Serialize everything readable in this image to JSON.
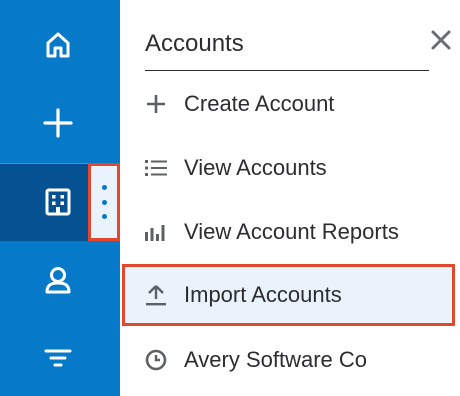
{
  "sidebar": {
    "items": [
      {
        "name": "home",
        "icon": "home-icon"
      },
      {
        "name": "create",
        "icon": "plus-icon"
      },
      {
        "name": "accounts",
        "icon": "building-icon",
        "active": true
      },
      {
        "name": "contacts",
        "icon": "person-icon"
      },
      {
        "name": "filter",
        "icon": "filter-icon"
      }
    ],
    "accent_color": "#0679c8",
    "active_color": "#065192"
  },
  "menu": {
    "title": "Accounts",
    "close_icon": "close-icon",
    "items": [
      {
        "label": "Create Account",
        "icon": "plus-icon"
      },
      {
        "label": "View Accounts",
        "icon": "list-icon"
      },
      {
        "label": "View Account Reports",
        "icon": "bar-chart-icon"
      },
      {
        "label": "Import Accounts",
        "icon": "upload-icon",
        "highlighted": true
      },
      {
        "label": "Avery Software Co",
        "icon": "clock-icon"
      }
    ]
  },
  "highlight_color": "#e2472f"
}
